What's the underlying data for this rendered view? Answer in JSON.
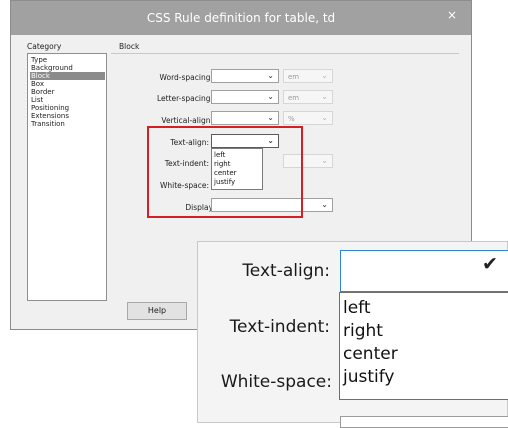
{
  "dialog": {
    "title": "CSS Rule definition for table, td",
    "close_glyph": "×",
    "category_heading": "Category",
    "section_heading": "Block",
    "categories": [
      "Type",
      "Background",
      "Block",
      "Box",
      "Border",
      "List",
      "Positioning",
      "Extensions",
      "Transition"
    ],
    "selected_category": "Block",
    "fields": {
      "word_spacing": {
        "label": "Word-spacing:",
        "value": "",
        "unit": "em"
      },
      "letter_spacing": {
        "label": "Letter-spacing:",
        "value": "",
        "unit": "em"
      },
      "vertical_align": {
        "label": "Vertical-align:",
        "value": "",
        "unit": "%"
      },
      "text_align": {
        "label": "Text-align:",
        "value": ""
      },
      "text_indent": {
        "label": "Text-indent:",
        "value": ""
      },
      "white_space": {
        "label": "White-space:",
        "value": ""
      },
      "display": {
        "label": "Display:",
        "value": ""
      }
    },
    "text_align_options": [
      "left",
      "right",
      "center",
      "justify"
    ],
    "help_label": "Help",
    "highlight_color": "#d61e25"
  },
  "zoom": {
    "text_align_label": "Text-align:",
    "text_indent_label": "Text-indent:",
    "white_space_label": "White-space:",
    "options": [
      "left",
      "right",
      "center",
      "justify"
    ]
  },
  "icons": {
    "dropdown": "chevron-down-icon",
    "close": "close-icon"
  }
}
